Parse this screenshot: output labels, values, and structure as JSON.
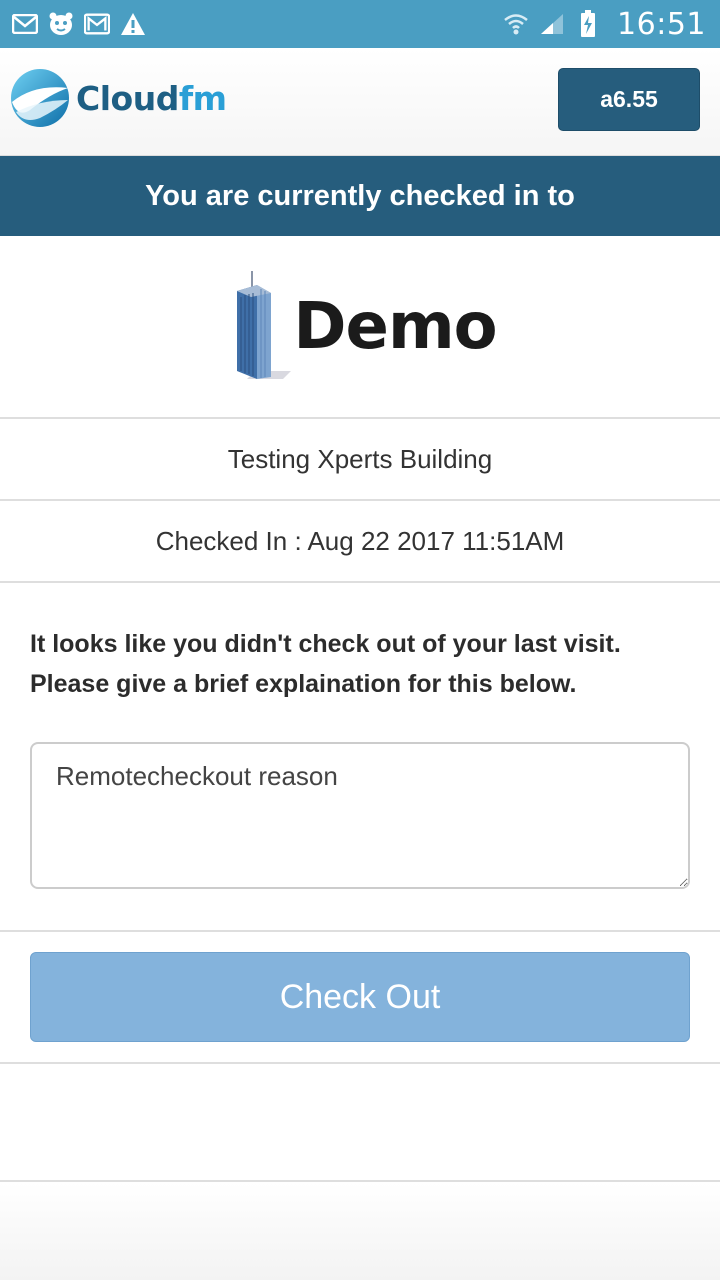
{
  "status_bar": {
    "left_icons": [
      "mail-icon",
      "tiger-face-icon",
      "gmail-icon",
      "warning-icon"
    ],
    "right_icons": [
      "wifi-icon",
      "signal-icon",
      "battery-charging-icon"
    ],
    "time": "16:51",
    "color": "#4a9ec2"
  },
  "header": {
    "logo_text_main": "Cloud",
    "logo_text_accent": "fm",
    "version_label": "a6.55",
    "accent_color": "#265d7d"
  },
  "banner": {
    "text": "You are currently checked in to"
  },
  "site": {
    "logo_text": "Demo",
    "building_name": "Testing Xperts Building",
    "checked_in_label": "Checked In : Aug 22 2017 11:51AM"
  },
  "form": {
    "message_line1": "It looks like you didn't check out of your last visit.",
    "message_line2": "Please give a brief explaination for this below.",
    "reason_value": "Remotecheckout reason",
    "submit_label": "Check Out",
    "submit_color": "#84b3dc"
  }
}
